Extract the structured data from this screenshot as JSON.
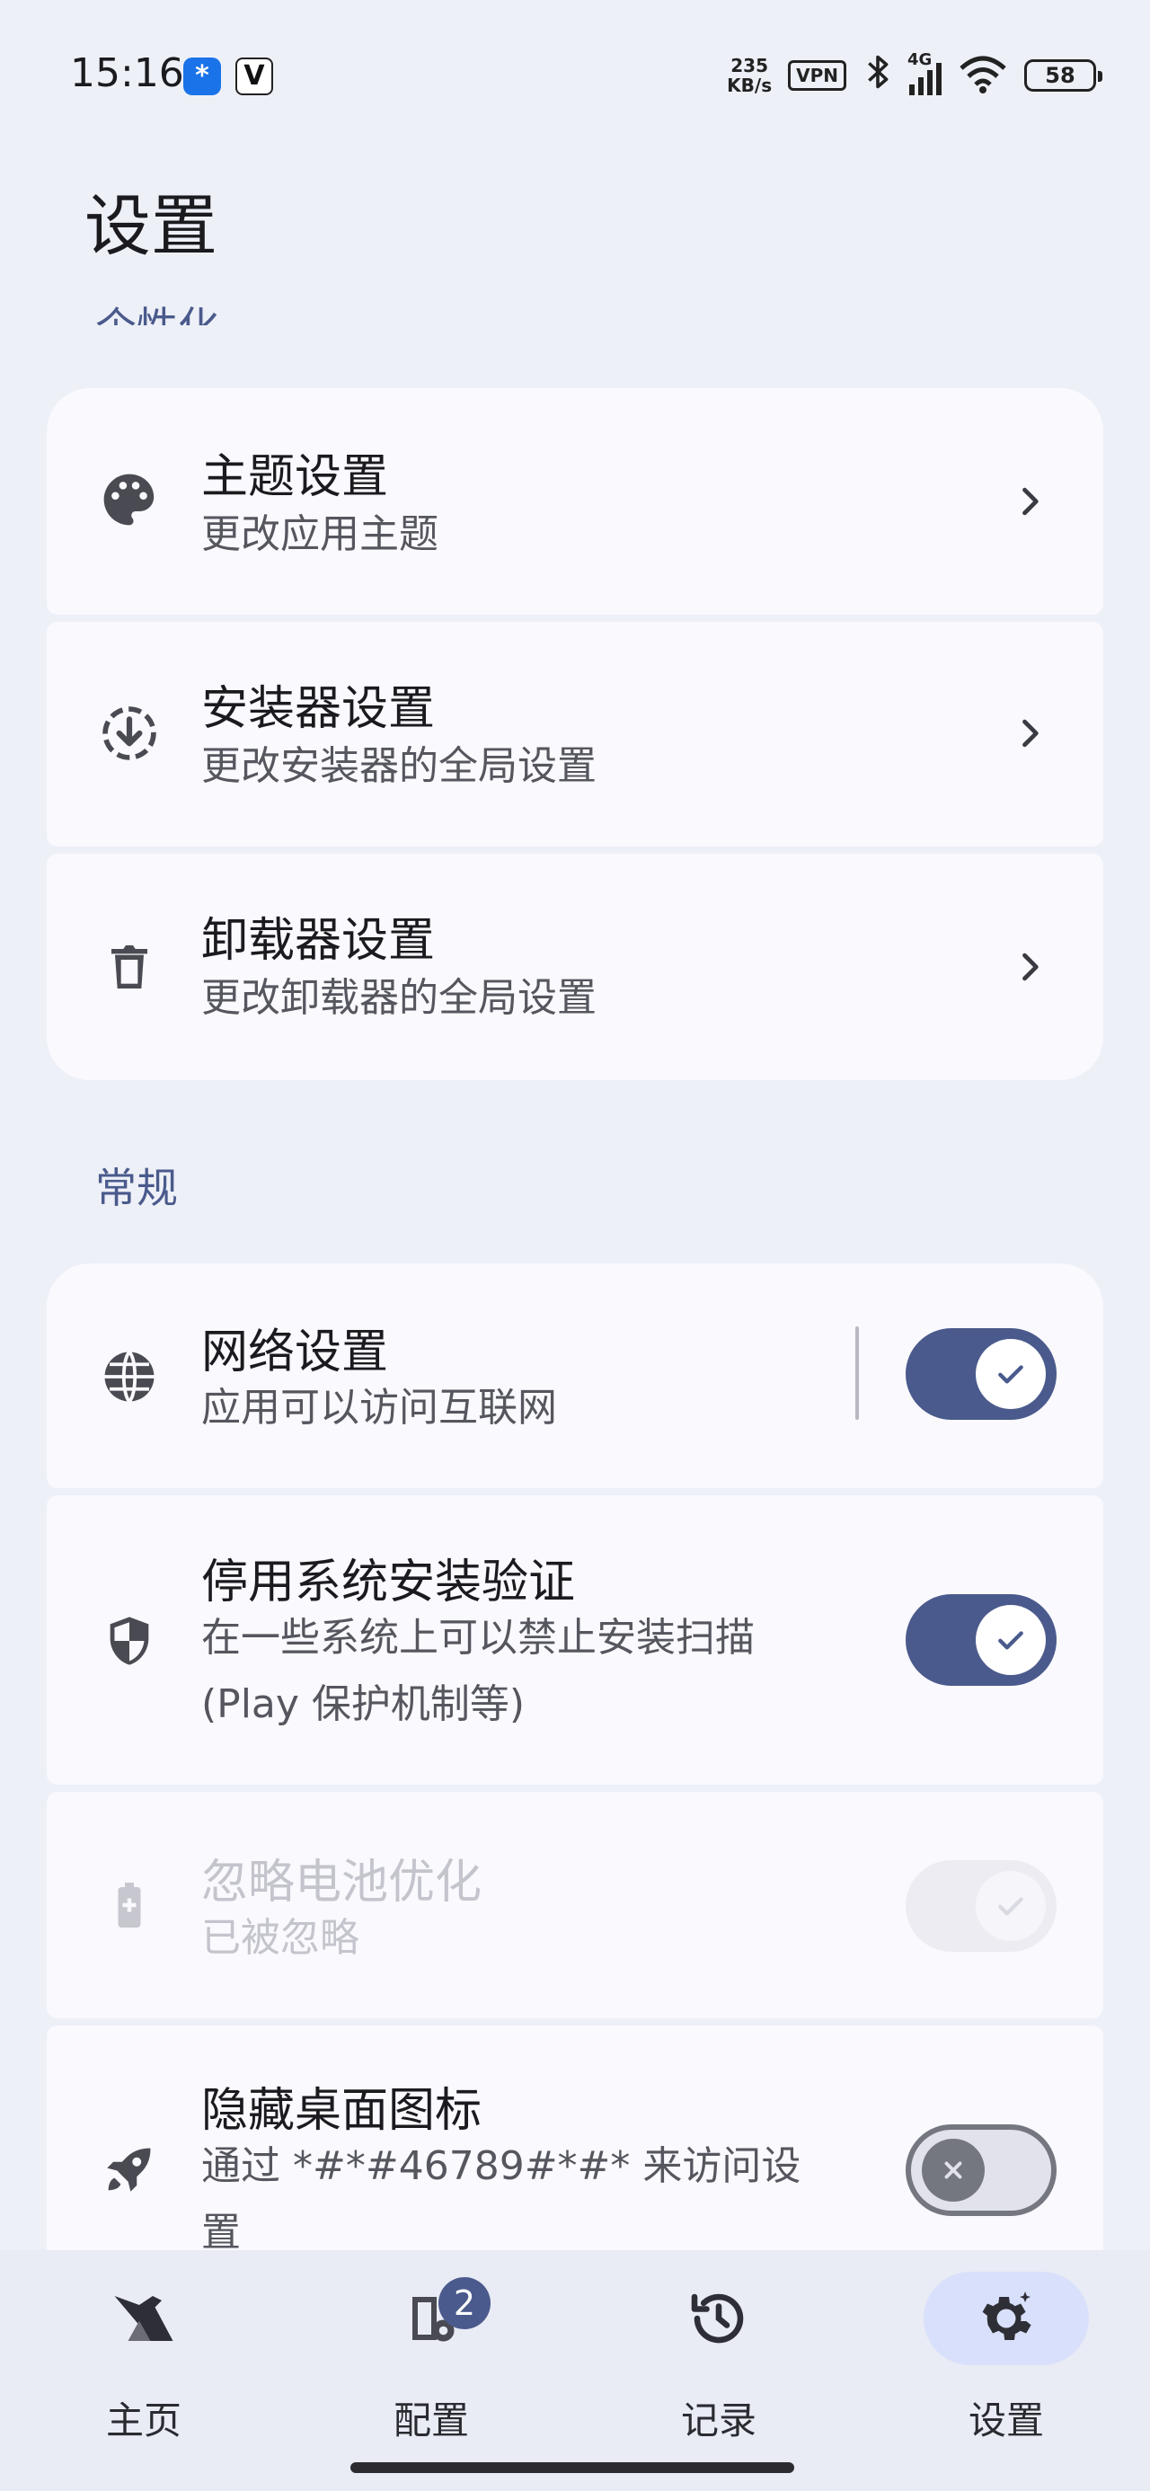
{
  "status": {
    "time": "15:16",
    "app1": "*",
    "app2": "V",
    "speed_top": "235",
    "speed_bottom": "KB/s",
    "vpn": "VPN",
    "network": "4G",
    "battery": "58"
  },
  "page": {
    "title": "设置"
  },
  "sections": {
    "personalization": "个性化",
    "general": "常规"
  },
  "personalization_items": [
    {
      "title": "主题设置",
      "subtitle": "更改应用主题",
      "icon": "palette-icon"
    },
    {
      "title": "安装器设置",
      "subtitle": "更改安装器的全局设置",
      "icon": "download-circle-icon"
    },
    {
      "title": "卸载器设置",
      "subtitle": "更改卸载器的全局设置",
      "icon": "trash-icon"
    }
  ],
  "general_items": [
    {
      "title": "网络设置",
      "subtitle": "应用可以访问互联网",
      "icon": "globe-icon",
      "checked": true
    },
    {
      "title": "停用系统安装验证",
      "subtitle_line1": "在一些系统上可以禁止安装扫描",
      "subtitle_line2": "(Play 保护机制等)",
      "icon": "shield-icon",
      "checked": true
    },
    {
      "title": "忽略电池优化",
      "subtitle": "已被忽略",
      "icon": "battery-icon",
      "checked": true,
      "disabled": true
    },
    {
      "title": "隐藏桌面图标",
      "subtitle_line1": "通过 *#*#46789#*#* 来访问设",
      "subtitle_line2": "置",
      "icon": "rocket-icon",
      "checked": false
    }
  ],
  "nav": {
    "items": [
      {
        "label": "主页",
        "icon": "bird-icon"
      },
      {
        "label": "配置",
        "icon": "config-icon",
        "badge": "2"
      },
      {
        "label": "记录",
        "icon": "history-icon"
      },
      {
        "label": "设置",
        "icon": "gear-icon",
        "active": true
      }
    ]
  },
  "colors": {
    "accent": "#4a5a8c",
    "background": "#eef0f8",
    "card": "#f9f9fe",
    "nav_active": "#d9e0fb"
  }
}
